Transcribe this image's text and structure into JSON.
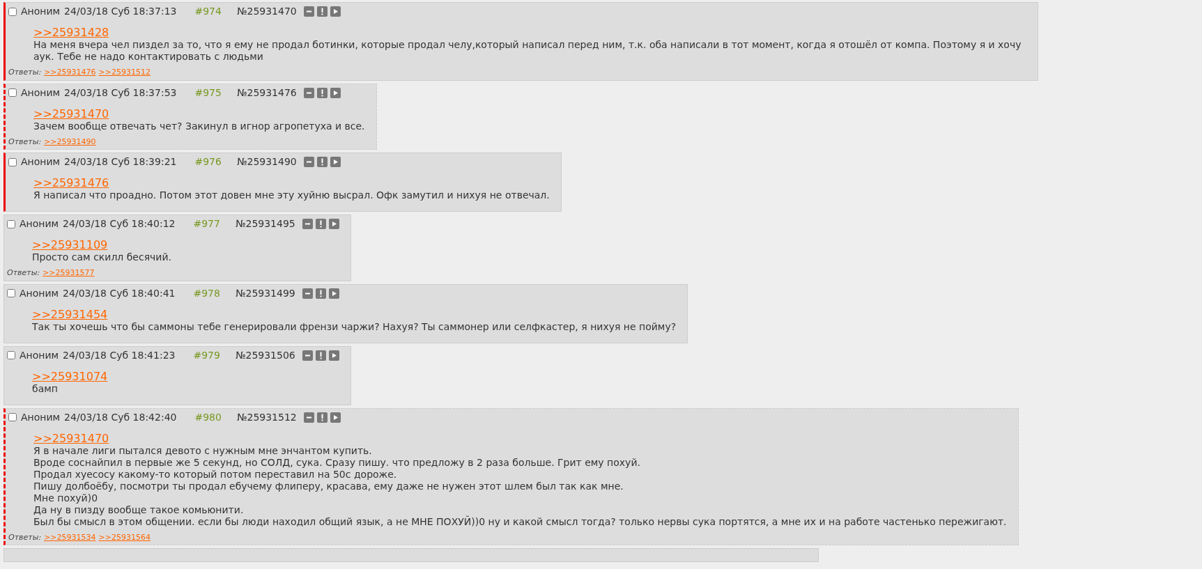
{
  "posts": [
    {
      "checked": false,
      "name": "Аноним",
      "date": "24/03/18 Суб 18:37:13",
      "num": "#974",
      "id": "№25931470",
      "marked": true,
      "dashed": false,
      "quote": ">>25931428",
      "text": "На меня вчера чел пиздел за то, что я ему не продал ботинки, которые продал челу,который написал перед ним, т.к. оба написали в тот момент, когда я отошёл от компа. Поэтому я и хочу аук. Тебе не надо контактировать с людьми",
      "replies_label": "Ответы:",
      "replies": [
        ">>25931476",
        ">>25931512"
      ]
    },
    {
      "checked": false,
      "name": "Аноним",
      "date": "24/03/18 Суб 18:37:53",
      "num": "#975",
      "id": "№25931476",
      "marked": true,
      "dashed": true,
      "quote": ">>25931470",
      "text": "Зачем вообще отвечать чет? Закинул в игнор агропетуха и все.",
      "replies_label": "Ответы:",
      "replies": [
        ">>25931490"
      ]
    },
    {
      "checked": false,
      "name": "Аноним",
      "date": "24/03/18 Суб 18:39:21",
      "num": "#976",
      "id": "№25931490",
      "marked": true,
      "dashed": false,
      "quote": ">>25931476",
      "text": "Я написал что проадно. Потом этот довен мне эту хуйню высрал. Офк замутил и нихуя не отвечал."
    },
    {
      "checked": false,
      "name": "Аноним",
      "date": "24/03/18 Суб 18:40:12",
      "num": "#977",
      "id": "№25931495",
      "marked": false,
      "dashed": false,
      "quote": ">>25931109",
      "text": "Просто сам скилл бесячий.",
      "replies_label": "Ответы:",
      "replies": [
        ">>25931577"
      ]
    },
    {
      "checked": false,
      "name": "Аноним",
      "date": "24/03/18 Суб 18:40:41",
      "num": "#978",
      "id": "№25931499",
      "marked": false,
      "dashed": false,
      "quote": ">>25931454",
      "text": "Так ты хочешь что бы саммоны тебе генерировали френзи чаржи? Нахуя? Ты саммонер или селфкастер, я нихуя не пойму?"
    },
    {
      "checked": false,
      "name": "Аноним",
      "date": "24/03/18 Суб 18:41:23",
      "num": "#979",
      "id": "№25931506",
      "marked": false,
      "dashed": false,
      "quote": ">>25931074",
      "text": "бамп"
    },
    {
      "checked": false,
      "name": "Аноним",
      "date": "24/03/18 Суб 18:42:40",
      "num": "#980",
      "id": "№25931512",
      "marked": true,
      "dashed": true,
      "quote": ">>25931470",
      "text": "Я в начале лиги пытался девото с нужным мне энчантом купить.\nВроде соснайпил в первые же 5 секунд, но СОЛД, сука. Сразу пишу. что предложу в 2 раза больше. Грит ему похуй.\nПродал хуесосу какому-то который потом переставил на 50с дороже.\nПишу долбоёбу, посмотри ты продал ебучему флиперу, красава, ему даже не нужен этот шлем был так как мне.\nМне похуй)0\nДа ну в пизду вообще такое комьюнити.\nБыл бы смысл в этом общении. если бы люди находил общий язык, а не МНЕ ПОХУЙ))0 ну и какой смысл тогда? только нервы сука портятся, а мне их и на работе частенько пережигают.",
      "replies_label": "Ответы:",
      "replies": [
        ">>25931534",
        ">>25931564"
      ]
    }
  ]
}
